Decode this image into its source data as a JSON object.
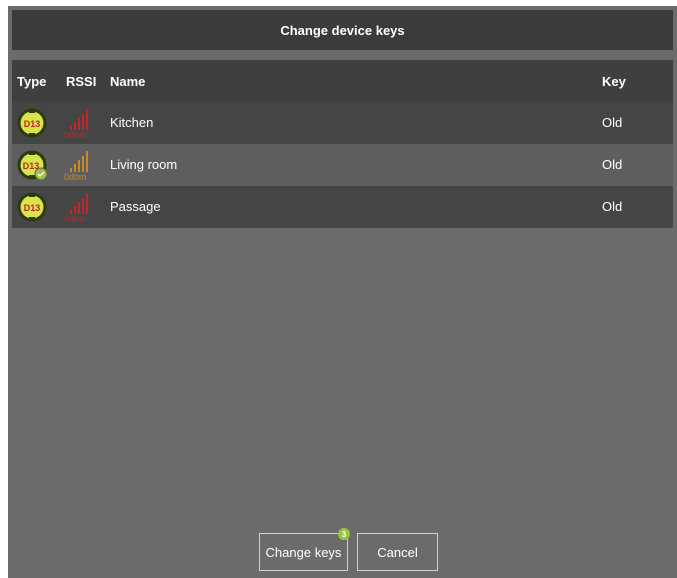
{
  "dialog": {
    "title": "Change device keys"
  },
  "table": {
    "headers": {
      "type": "Type",
      "rssi": "RSSI",
      "name": "Name",
      "key": "Key"
    },
    "rows": [
      {
        "type_icon": "d13-plug-icon",
        "type_label": "D13",
        "rssi_label": "0dbm",
        "rssi_color": "#c0262c",
        "name": "Kitchen",
        "key": "Old",
        "has_check": false
      },
      {
        "type_icon": "d13-plug-check-icon",
        "type_label": "D13",
        "rssi_label": "0dbm",
        "rssi_color": "#c8892a",
        "name": "Living room",
        "key": "Old",
        "has_check": true
      },
      {
        "type_icon": "d13-plug-icon",
        "type_label": "D13",
        "rssi_label": "0dbm",
        "rssi_color": "#c0262c",
        "name": "Passage",
        "key": "Old",
        "has_check": false
      }
    ]
  },
  "buttons": {
    "change_keys": "Change keys",
    "change_keys_badge": "3",
    "cancel": "Cancel"
  },
  "colors": {
    "accent_green": "#9cc43a",
    "icon_yellow": "#d9e34a"
  }
}
